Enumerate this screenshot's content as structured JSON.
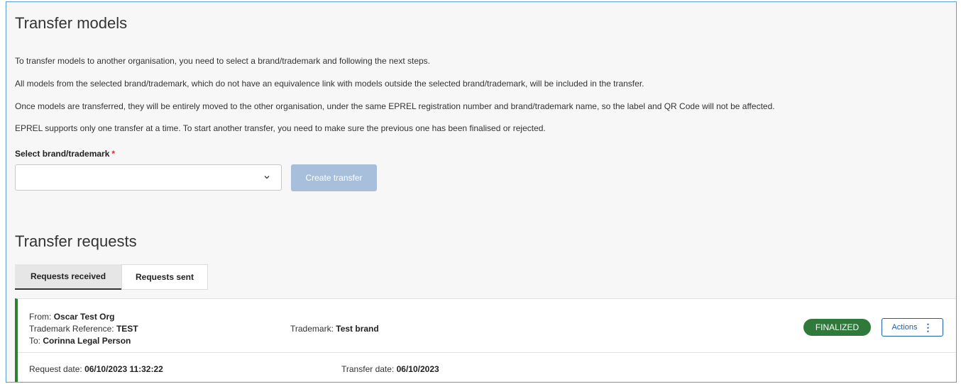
{
  "transfer_models": {
    "title": "Transfer models",
    "paragraphs": [
      "To transfer models to another organisation, you need to select a brand/trademark and following the next steps.",
      "All models from the selected brand/trademark, which do not have an equivalence link with models outside the selected brand/trademark, will be included in the transfer.",
      "Once models are transferred, they will be entirely moved to the other organisation, under the same EPREL registration number and brand/trademark name, so the label and QR Code will not be affected.",
      "EPREL supports only one transfer at a time. To start another transfer, you need to make sure the previous one has been finalised or rejected."
    ],
    "select_label": "Select brand/trademark",
    "required_mark": "*",
    "select_value": "",
    "create_button": "Create transfer"
  },
  "transfer_requests": {
    "title": "Transfer requests",
    "tabs": [
      {
        "label": "Requests received",
        "active": true
      },
      {
        "label": "Requests sent",
        "active": false
      }
    ],
    "request": {
      "from_label": "From:",
      "from_value": "Oscar Test Org",
      "trademark_ref_label": "Trademark Reference:",
      "trademark_ref_value": "TEST",
      "to_label": "To:",
      "to_value": "Corinna Legal Person",
      "trademark_label": "Trademark:",
      "trademark_value": "Test brand",
      "status": "FINALIZED",
      "actions_label": "Actions",
      "request_date_label": "Request date:",
      "request_date_value": "06/10/2023 11:32:22",
      "transfer_date_label": "Transfer date:",
      "transfer_date_value": "06/10/2023"
    }
  },
  "colors": {
    "accent": "#1f5fa8",
    "status_green": "#2f7a3a",
    "card_border": "#2e7d32",
    "create_button_disabled": "#a7bfdb",
    "required": "#d32f2f"
  },
  "icons": {
    "select_chevron": "chevron-down-icon",
    "actions_menu": "vertical-dots-icon"
  }
}
